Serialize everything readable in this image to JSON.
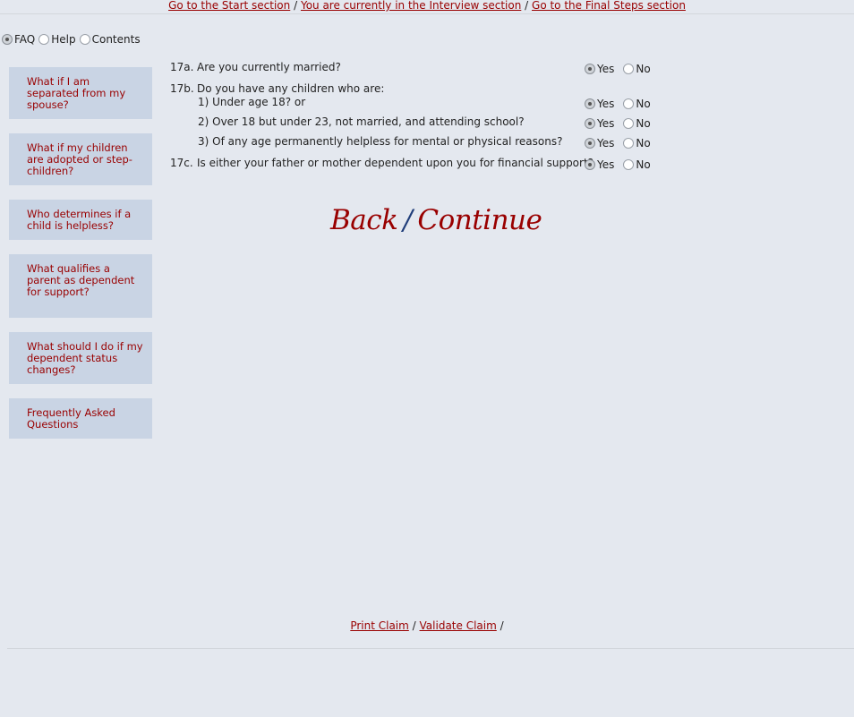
{
  "topnav": {
    "start": "Go to the Start section",
    "interview": "You are currently in the Interview section",
    "final": "Go to the Final Steps section",
    "sep": "/"
  },
  "tabs": [
    {
      "label": "FAQ",
      "selected": true
    },
    {
      "label": "Help",
      "selected": false
    },
    {
      "label": "Contents",
      "selected": false
    }
  ],
  "faq": [
    "What if I am separated from my spouse?",
    "What if my children are adopted or step-children?",
    "Who determines if a child is helpless?",
    "What qualifies a parent as dependent for support?",
    "What should I do if my dependent status changes?",
    "Frequently Asked Questions"
  ],
  "questions": {
    "q17a": {
      "num": "17a.",
      "text": "Are you currently married?",
      "answer": "Yes"
    },
    "q17b": {
      "num": "17b.",
      "text": "Do you have any children who are:"
    },
    "q17b1": {
      "text": "1) Under age 18? or",
      "answer": "Yes"
    },
    "q17b2": {
      "text": "2) Over 18 but under 23, not married, and attending school?",
      "answer": "Yes"
    },
    "q17b3": {
      "text": "3) Of any age permanently helpless for mental or physical reasons?",
      "answer": "Yes"
    },
    "q17c": {
      "num": "17c.",
      "text": "Is either your father or mother dependent upon you for financial support?",
      "answer": "Yes"
    }
  },
  "options": {
    "yes": "Yes",
    "no": "No"
  },
  "nav": {
    "back": "Back",
    "slash": "/",
    "continue": "Continue"
  },
  "bottom": {
    "print": "Print Claim",
    "validate": "Validate Claim",
    "sep": "/"
  }
}
